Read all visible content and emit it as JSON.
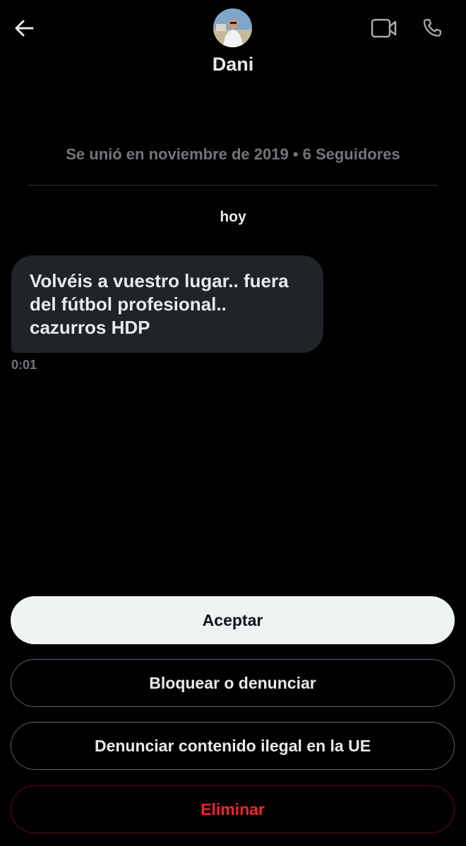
{
  "header": {
    "back_icon": "arrow-left-icon",
    "video_icon": "video-camera-icon",
    "call_icon": "phone-icon",
    "contact_name": "Dani"
  },
  "profile": {
    "joined_text": "Se unió en noviembre de 2019 • 6 Seguidores"
  },
  "conversation": {
    "day_label": "hoy",
    "messages": [
      {
        "text": "Volvéis a vuestro lugar.. fuera del fútbol profesional.. cazurros HDP",
        "time": "0:01"
      }
    ]
  },
  "actions": {
    "accept": "Aceptar",
    "block_or_report": "Bloquear o denunciar",
    "report_illegal_eu": "Denunciar contenido ilegal en la UE",
    "delete": "Eliminar"
  },
  "colors": {
    "background": "#000000",
    "bubble": "#202327",
    "muted_text": "#71767b",
    "delete_red": "#f4212e"
  }
}
